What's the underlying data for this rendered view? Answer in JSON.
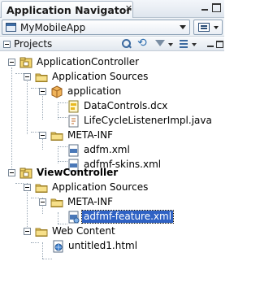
{
  "window": {
    "title": "Application Navigator",
    "close_glyph": "✕"
  },
  "app_selector": {
    "value": "MyMobileApp"
  },
  "section": {
    "title": "Projects"
  },
  "tree": {
    "app_controller": "ApplicationController",
    "ac_app_sources": "Application Sources",
    "ac_application": "application",
    "ac_datacontrols": "DataControls.dcx",
    "ac_lifecycle": "LifeCycleListenerImpl.java",
    "ac_metainf": "META-INF",
    "ac_adfm": "adfm.xml",
    "ac_adfmf_skins": "adfmf-skins.xml",
    "view_controller": "ViewController",
    "vc_app_sources": "Application Sources",
    "vc_metainf": "META-INF",
    "vc_feature": "adfmf-feature.xml",
    "vc_web_content": "Web Content",
    "vc_untitled": "untitled1.html"
  },
  "colors": {
    "selection": "#2f62c4",
    "folder": "#e9c75a"
  }
}
